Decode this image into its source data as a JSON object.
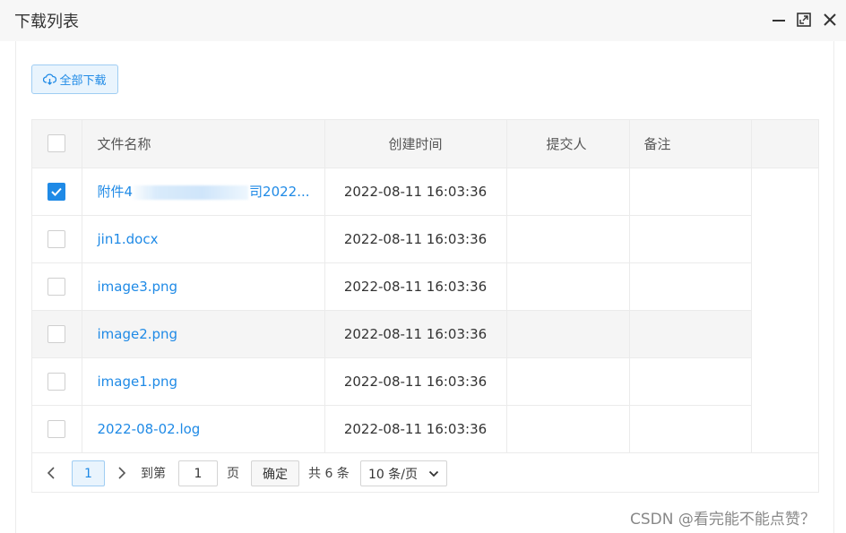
{
  "dialog": {
    "title": "下载列表"
  },
  "toolbar": {
    "download_all_label": "全部下载"
  },
  "table": {
    "headers": {
      "name": "文件名称",
      "created": "创建时间",
      "submitter": "提交人",
      "note": "备注"
    },
    "rows": [
      {
        "checked": true,
        "name_prefix": "附件4",
        "name_suffix": "司2022...",
        "created": "2022-08-11 16:03:36",
        "submitter": "",
        "note": ""
      },
      {
        "checked": false,
        "name": "jin1.docx",
        "created": "2022-08-11 16:03:36",
        "submitter": "",
        "note": ""
      },
      {
        "checked": false,
        "name": "image3.png",
        "created": "2022-08-11 16:03:36",
        "submitter": "",
        "note": ""
      },
      {
        "checked": false,
        "name": "image2.png",
        "created": "2022-08-11 16:03:36",
        "submitter": "",
        "note": ""
      },
      {
        "checked": false,
        "name": "image1.png",
        "created": "2022-08-11 16:03:36",
        "submitter": "",
        "note": ""
      },
      {
        "checked": false,
        "name": "2022-08-02.log",
        "created": "2022-08-11 16:03:36",
        "submitter": "",
        "note": ""
      }
    ]
  },
  "pagination": {
    "current_page": "1",
    "goto_prefix": "到第",
    "goto_value": "1",
    "goto_suffix": "页",
    "confirm_label": "确定",
    "total_text": "共 6 条",
    "page_size_value": "10 条/页"
  },
  "watermark": "CSDN @看完能不能点赞？",
  "colors": {
    "accent": "#1f8ae6",
    "accent_bg": "#e9f4fd",
    "header_bg": "#f5f5f5"
  }
}
